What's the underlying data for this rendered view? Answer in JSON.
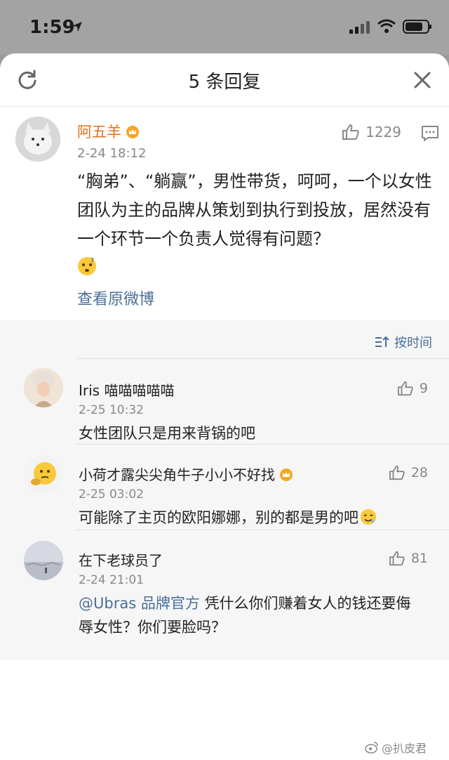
{
  "status_bar": {
    "time": "1:59"
  },
  "sheet": {
    "title": "5 条回复"
  },
  "main_comment": {
    "name": "阿五羊",
    "date": "2-24 18:12",
    "likes": "1229",
    "text": "“胸弟”、“躺赢”，男性带货，呵呵，一个以女性团队为主的品牌从策划到执行到投放，居然没有一个环节一个负责人觉得有问题？",
    "view_original": "查看原微博"
  },
  "sort_label": "按时间",
  "replies": [
    {
      "name": "Iris 喵喵喵喵喵",
      "date": "2-25 10:32",
      "likes": "9",
      "text": "女性团队只是用来背锅的吧"
    },
    {
      "name": "小荷才露尖尖角牛子小小不好找",
      "date": "2-25 03:02",
      "likes": "28",
      "text": "可能除了主页的欧阳娜娜，别的都是男的吧"
    },
    {
      "name": "在下老球员了",
      "date": "2-24 21:01",
      "likes": "81",
      "mention": "@Ubras 品牌官方",
      "text": " 凭什么你们赚着女人的钱还要侮辱女性？你们要脸吗？"
    }
  ],
  "watermark": "@扒皮君",
  "colors": {
    "accent_orange": "#e0701a",
    "link_blue": "#4a6f9a",
    "muted": "#888888"
  }
}
